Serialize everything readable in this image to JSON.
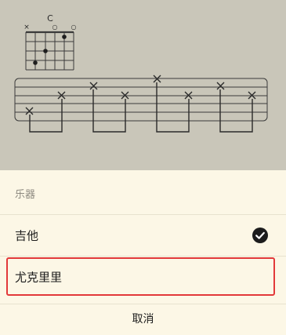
{
  "preview": {
    "chord_name": "C",
    "string_markers": [
      "×",
      "",
      "",
      "○",
      "",
      "○"
    ],
    "diagram_kind": "chord-fingering"
  },
  "sheet": {
    "title": "乐器",
    "options": [
      {
        "label": "吉他",
        "selected": true,
        "icon": "check-icon"
      },
      {
        "label": "尤克里里",
        "selected": false,
        "highlighted": true
      }
    ],
    "cancel_label": "取消"
  },
  "colors": {
    "preview_bg": "#c9c6b9",
    "sheet_bg": "#fcf7e6",
    "highlight_border": "#e2393a",
    "check_fill": "#1c1c1c"
  }
}
